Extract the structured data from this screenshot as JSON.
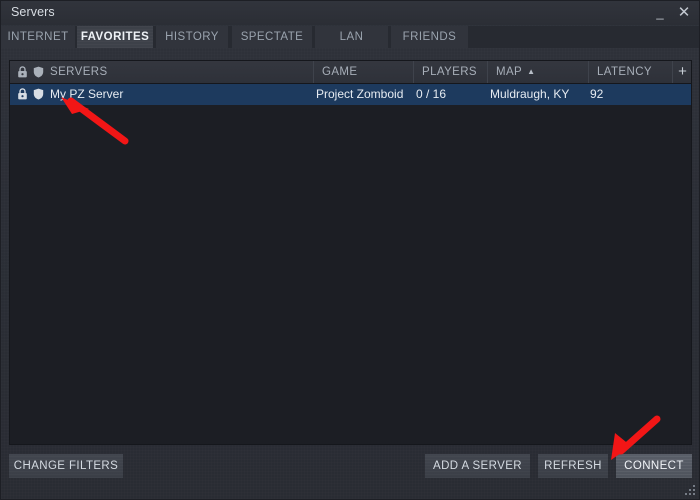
{
  "window": {
    "title": "Servers",
    "minimize_label": "_",
    "close_label": "✕",
    "minimize_icon": "minimize-icon",
    "close_icon": "close-icon"
  },
  "tabs": [
    {
      "label": "INTERNET",
      "active": false
    },
    {
      "label": "FAVORITES",
      "active": true
    },
    {
      "label": "HISTORY",
      "active": false
    },
    {
      "label": "SPECTATE",
      "active": false
    },
    {
      "label": "LAN",
      "active": false
    },
    {
      "label": "FRIENDS",
      "active": false
    }
  ],
  "server_list": {
    "columns": [
      {
        "label": "SERVERS",
        "sorted": false,
        "sort_arrow": ""
      },
      {
        "label": "GAME",
        "sorted": false,
        "sort_arrow": ""
      },
      {
        "label": "PLAYERS",
        "sorted": false,
        "sort_arrow": ""
      },
      {
        "label": "MAP",
        "sorted": true,
        "sort_arrow": "▲"
      },
      {
        "label": "LATENCY",
        "sorted": false,
        "sort_arrow": ""
      }
    ],
    "add_column_label": "+",
    "header_icons": [
      "lock-icon",
      "shield-icon"
    ],
    "rows": [
      {
        "selected": true,
        "lock_icon": "lock-icon",
        "shield_icon": "shield-icon",
        "name": "My PZ Server",
        "game": "Project Zomboid",
        "players": "0 / 16",
        "map": "Muldraugh, KY",
        "latency": "92"
      }
    ]
  },
  "footer": {
    "change_filters_label": "CHANGE FILTERS",
    "add_server_label": "ADD A SERVER",
    "refresh_label": "REFRESH",
    "connect_label": "CONNECT"
  },
  "annotations": {
    "arrow_color": "#f21616",
    "arrow_server_target": "server-row",
    "arrow_connect_target": "connect-button"
  },
  "colors": {
    "window_bg": "#2b2e36",
    "titlebar_bg": "#31343c",
    "tab_bg": "#31343c",
    "tab_active_bg": "#3d4149",
    "list_bg": "#1c1e24",
    "header_bg": "#34373f",
    "row_selected_bg": "#1d3a5e",
    "text_primary": "#e6ebf1",
    "text_muted": "#9aa3ae",
    "button_bg": "#3e424b",
    "button_hover_bg": "#555a64",
    "accent_red": "#f21616"
  }
}
